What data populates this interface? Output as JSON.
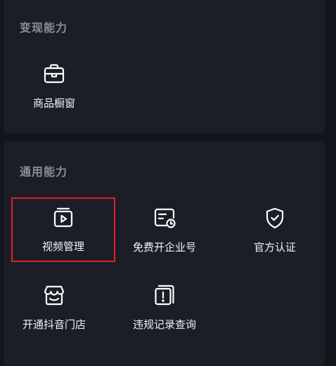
{
  "sections": {
    "monetize": {
      "title": "变现能力",
      "tools": [
        {
          "label": "商品橱窗",
          "icon": "shopping-bag-icon"
        }
      ]
    },
    "general": {
      "title": "通用能力",
      "tools": [
        {
          "label": "视频管理",
          "icon": "video-play-icon",
          "highlight": true
        },
        {
          "label": "免费开企业号",
          "icon": "enterprise-clock-icon"
        },
        {
          "label": "官方认证",
          "icon": "shield-check-icon"
        },
        {
          "label": "开通抖音门店",
          "icon": "storefront-icon"
        },
        {
          "label": "违规记录查询",
          "icon": "violation-record-icon"
        }
      ]
    }
  },
  "colors": {
    "background": "#13151c",
    "card": "#1c1e27",
    "section_title": "#8c8e97",
    "label": "#f2f2f4",
    "highlight_border": "#e0202a"
  }
}
